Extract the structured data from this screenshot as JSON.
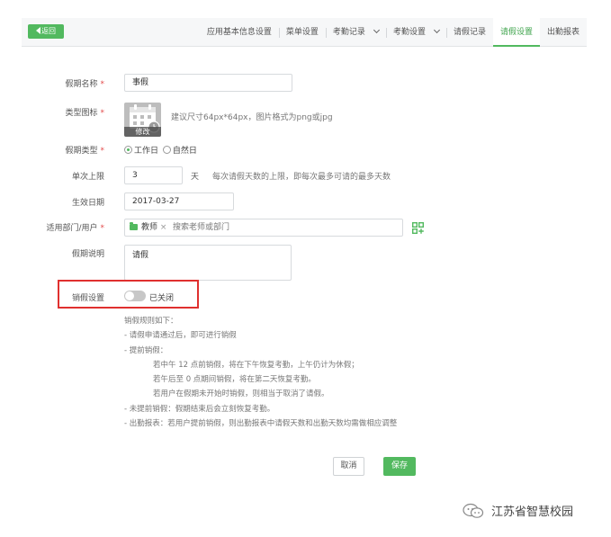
{
  "topbar": {
    "back_label": "返回",
    "tabs": [
      {
        "label": "应用基本信息设置",
        "dropdown": false,
        "active": false
      },
      {
        "label": "菜单设置",
        "dropdown": false,
        "active": false
      },
      {
        "label": "考勤记录",
        "dropdown": true,
        "active": false
      },
      {
        "label": "考勤设置",
        "dropdown": true,
        "active": false
      },
      {
        "label": "请假记录",
        "dropdown": false,
        "active": false
      },
      {
        "label": "请假设置",
        "dropdown": false,
        "active": true
      },
      {
        "label": "出勤报表",
        "dropdown": false,
        "active": false
      }
    ]
  },
  "form": {
    "name_label": "假期名称",
    "name_value": "事假",
    "icon_label": "类型图标",
    "icon_edit_label": "修改",
    "icon_hint": "建议尺寸64px*64px，图片格式为png或jpg",
    "type_label": "假期类型",
    "type_options": [
      "工作日",
      "自然日"
    ],
    "type_selected": "工作日",
    "limit_label": "单次上限",
    "limit_value": "3",
    "limit_unit": "天",
    "limit_hint": "每次请假天数的上限，即每次最多可请的最多天数",
    "date_label": "生效日期",
    "date_value": "2017-03-27",
    "scope_label": "适用部门/用户",
    "scope_tag": "教师",
    "scope_placeholder": "搜索老师或部门",
    "desc_label": "假期说明",
    "desc_value": "请假",
    "cancel_label": "销假设置",
    "cancel_toggle_text": "已关闭",
    "cancel_enabled": false
  },
  "rules": [
    {
      "text": "销假规则如下：",
      "indent": false
    },
    {
      "text": "- 请假申请通过后，即可进行销假",
      "indent": false
    },
    {
      "text": "- 提前销假：",
      "indent": false
    },
    {
      "text": "若中午 12 点前销假，将在下午恢复考勤，上午仍计为休假；",
      "indent": true
    },
    {
      "text": "若午后至 0 点期间销假，将在第二天恢复考勤。",
      "indent": true
    },
    {
      "text": "若用户在假期未开始时销假，则相当于取消了请假。",
      "indent": true
    },
    {
      "text": "- 未提前销假：假期结束后会立刻恢复考勤。",
      "indent": false
    },
    {
      "text": "- 出勤报表：若用户提前销假，则出勤报表中请假天数和出勤天数均需做相应调整",
      "indent": false
    }
  ],
  "actions": {
    "cancel_label": "取消",
    "save_label": "保存"
  },
  "watermark": {
    "text": "江苏省智慧校园"
  },
  "colors": {
    "accent": "#52b95f",
    "required": "#e24b4b",
    "highlight_border": "#e0302f"
  }
}
